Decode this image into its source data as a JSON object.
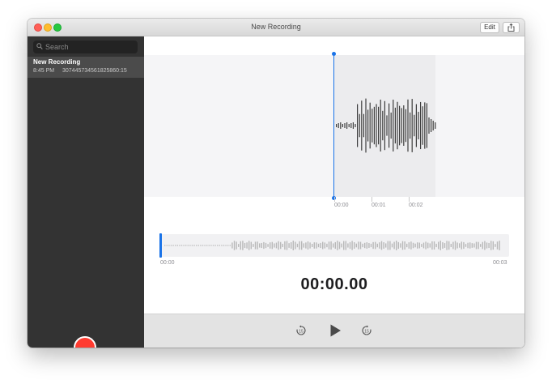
{
  "window": {
    "title": "New Recording"
  },
  "toolbar": {
    "edit_label": "Edit",
    "share_icon": "share-icon"
  },
  "sidebar": {
    "search_placeholder": "Search",
    "recordings": [
      {
        "name": "New Recording",
        "time": "8:45 PM",
        "duration": "3074457345618258​60:15"
      }
    ]
  },
  "graph": {
    "tick_labels": [
      "00:00",
      "00:01",
      "00:02"
    ]
  },
  "overview": {
    "start_label": "00:00",
    "end_label": "00:03"
  },
  "timer": "00:00.00",
  "controls": {
    "skip_back_seconds": "15",
    "skip_forward_seconds": "15"
  },
  "colors": {
    "accent": "#1a73e8",
    "record": "#ff3b30",
    "sidebar_bg": "#333333"
  }
}
